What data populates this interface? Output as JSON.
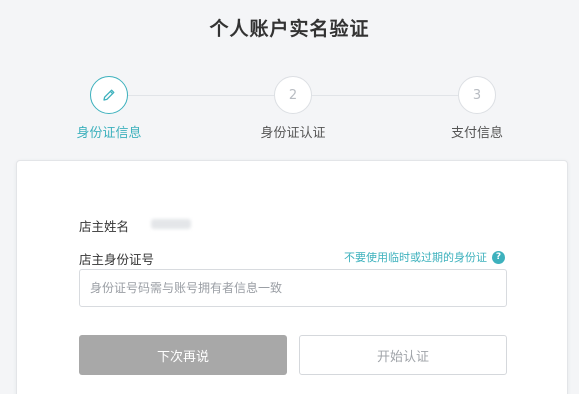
{
  "page": {
    "title": "个人账户实名验证"
  },
  "steps": [
    {
      "number": "",
      "icon": "pencil-icon",
      "label": "身份证信息",
      "active": true
    },
    {
      "number": "2",
      "label": "身份证认证",
      "active": false
    },
    {
      "number": "3",
      "label": "支付信息",
      "active": false
    }
  ],
  "form": {
    "owner_name_label": "店主姓名",
    "owner_id_label": "店主身份证号",
    "id_hint": "不要使用临时或过期的身份证",
    "help_icon_glyph": "?",
    "id_placeholder": "身份证号码需与账号拥有者信息一致"
  },
  "buttons": {
    "later_label": "下次再说",
    "start_label": "开始认证"
  },
  "colors": {
    "accent": "#3db1bd",
    "disabled_button": "#a8a8a8"
  }
}
